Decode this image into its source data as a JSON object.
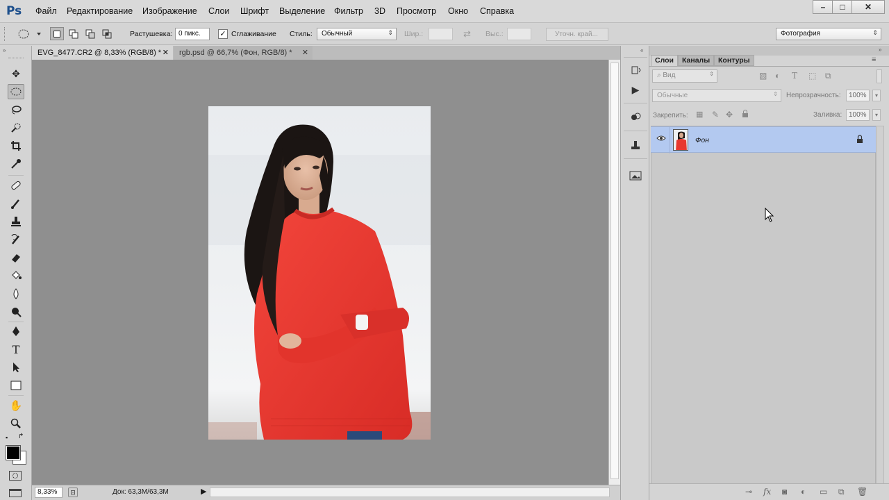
{
  "app": {
    "logo": "Ps"
  },
  "menu": [
    "Файл",
    "Редактирование",
    "Изображение",
    "Слои",
    "Шрифт",
    "Выделение",
    "Фильтр",
    "3D",
    "Просмотр",
    "Окно",
    "Справка"
  ],
  "window_controls": {
    "minimize": "–",
    "maximize": "□",
    "close": "✕"
  },
  "options": {
    "feather_label": "Растушевка:",
    "feather_value": "0 пикс.",
    "antialias_label": "Сглаживание",
    "antialias_checked": true,
    "style_label": "Стиль:",
    "style_value": "Обычный",
    "width_label": "Шир.:",
    "height_label": "Выс.:",
    "refine_edge": "Уточн. край...",
    "workspace": "Фотография"
  },
  "tabs": [
    {
      "title": "EVG_8477.CR2 @ 8,33% (RGB/8) *",
      "close": "✕"
    },
    {
      "title": "rgb.psd @ 66,7% (Фон, RGB/8) *",
      "close": "✕"
    }
  ],
  "status": {
    "zoom": "8,33%",
    "doc": "Док: 63,3M/63,3M"
  },
  "layers_panel": {
    "tabs": [
      "Слои",
      "Каналы",
      "Контуры"
    ],
    "filter_placeholder": "Вид",
    "blend_mode": "Обычные",
    "opacity_label": "Непрозрачность:",
    "opacity_value": "100%",
    "lock_label": "Закрепить:",
    "fill_label": "Заливка:",
    "fill_value": "100%",
    "layers": [
      {
        "name": "Фон",
        "visible": true,
        "locked": true
      }
    ]
  },
  "colors": {
    "accent_layer": "#b3c9f0",
    "canvas_bg": "#8f8f8f",
    "sweater": "#e8382f"
  },
  "icons": [
    "move-tool-icon",
    "ellipse-marquee-icon",
    "lasso-icon",
    "quick-select-icon",
    "crop-icon",
    "eyedropper-icon",
    "healing-brush-icon",
    "brush-icon",
    "clone-stamp-icon",
    "history-brush-icon",
    "eraser-icon",
    "paint-bucket-icon",
    "blur-icon",
    "dodge-icon",
    "pen-icon",
    "type-icon",
    "path-select-icon",
    "rectangle-icon",
    "hand-icon",
    "zoom-icon"
  ]
}
